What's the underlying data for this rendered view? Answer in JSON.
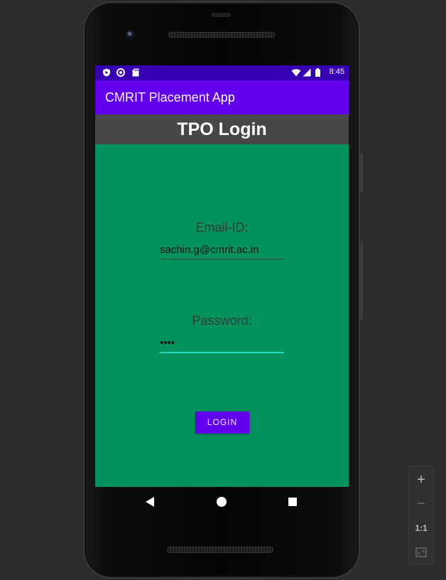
{
  "status_bar": {
    "time": "8:45",
    "left_icons": [
      "play-protect-icon",
      "sync-icon",
      "sd-card-icon"
    ],
    "right_icons": [
      "wifi-icon",
      "cell-signal-icon",
      "battery-icon"
    ]
  },
  "app_bar": {
    "title": "CMRIT Placement App"
  },
  "page": {
    "heading": "TPO Login"
  },
  "form": {
    "email_label": "Email-ID:",
    "email_value": "sachin.g@cmrit.ac.in",
    "password_label": "Password:",
    "password_value": "••••",
    "login_label": "LOGIN"
  },
  "nav_bar": {
    "icons": [
      "back-icon",
      "home-icon",
      "recent-apps-icon"
    ]
  },
  "zoom_controls": {
    "zoom_in": "+",
    "zoom_out": "−",
    "actual_size": "1:1",
    "fit_icon": "fit-screen-icon"
  },
  "colors": {
    "status_bar": "#3700b3",
    "app_bar": "#6200ee",
    "heading_bar": "#474747",
    "content_bg": "#03915e",
    "accent": "#16d9c4"
  }
}
